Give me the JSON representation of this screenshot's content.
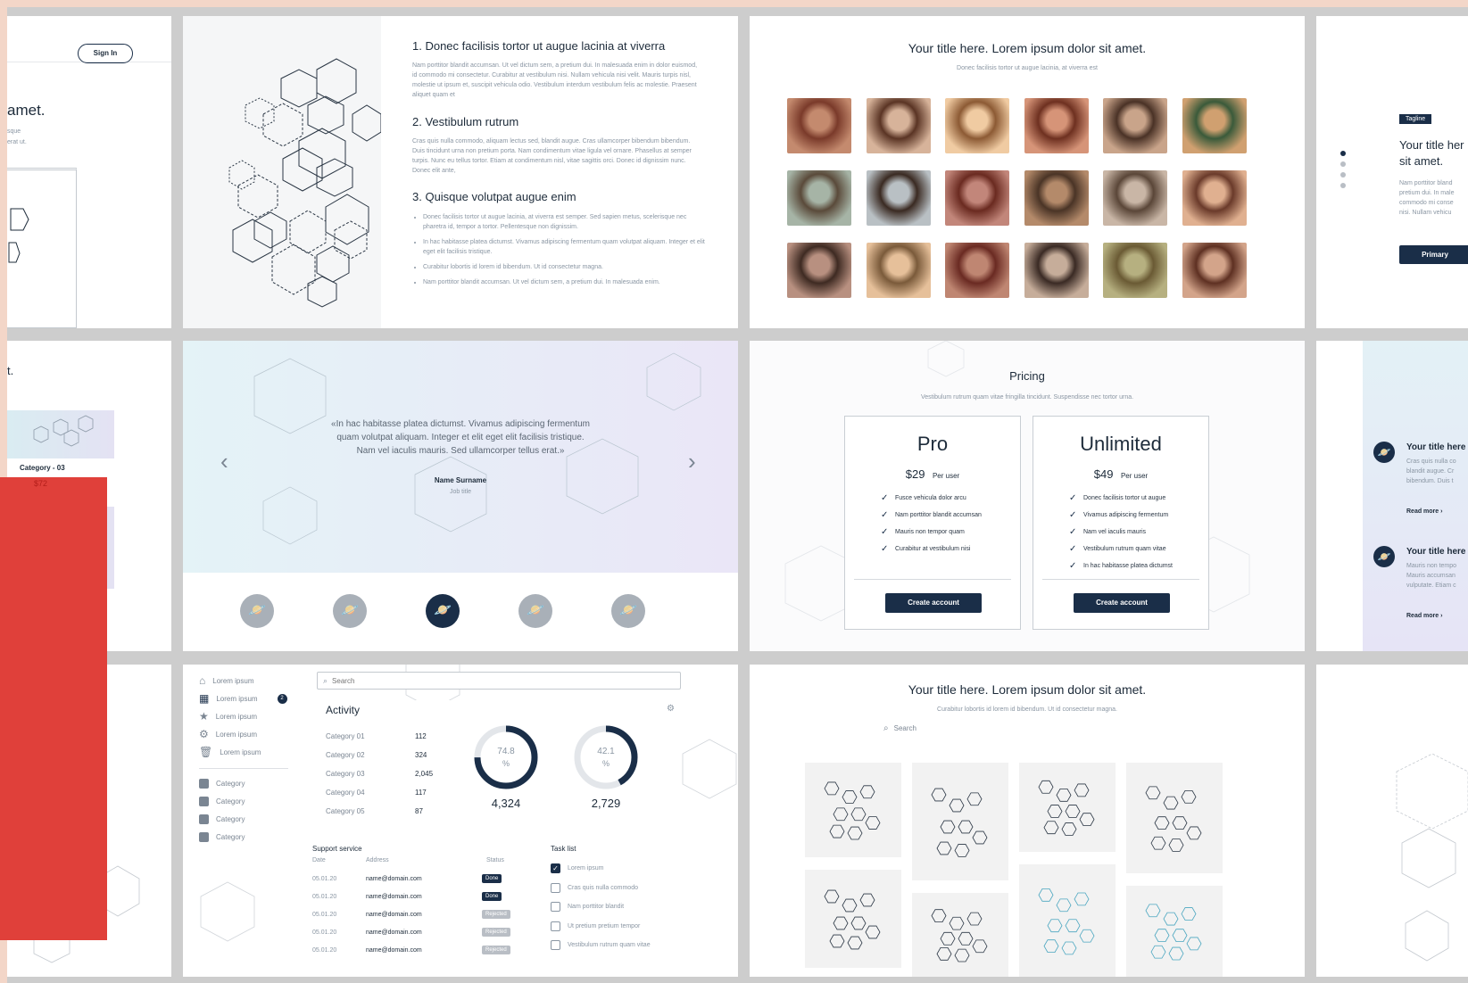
{
  "signin": {
    "button": "Sign In",
    "title_fragment": "amet.",
    "text_1": "sque",
    "text_2": "erat ut."
  },
  "list_card": {
    "heading_1": "1. Donec facilisis tortor ut augue lacinia at viverra",
    "para_1": "Nam porttitor blandit accumsan. Ut vel dictum sem, a pretium dui. In malesuada enim in dolor euismod, id commodo mi consectetur. Curabitur at vestibulum nisi. Nullam vehicula nisi velit. Mauris turpis nisl, molestie ut ipsum et, suscipit vehicula odio. Vestibulum interdum vestibulum felis ac molestie. Praesent aliquet quam et",
    "heading_2": "2. Vestibulum rutrum",
    "para_2": "Cras quis nulla commodo, aliquam lectus sed, blandit augue. Cras ullamcorper bibendum bibendum. Duis tincidunt urna non pretium porta. Nam condimentum vitae ligula vel ornare. Phasellus at semper turpis. Nunc eu tellus tortor. Etiam at condimentum nisl, vitae sagittis orci. Donec id dignissim nunc. Donec elit ante,",
    "heading_3": "3. Quisque volutpat augue enim",
    "bullets": [
      "Donec facilisis tortor ut augue lacinia, at viverra est semper. Sed sapien metus, scelerisque nec pharetra id, tempor a tortor. Pellentesque non dignissim.",
      "In hac habitasse platea dictumst. Vivamus adipiscing fermentum quam volutpat aliquam. Integer et elit eget elit facilisis tristique.",
      "Curabitur lobortis id lorem id bibendum. Ut id consectetur magna.",
      "Nam porttitor blandit accumsan. Ut vel dictum sem, a pretium dui. In malesuada enim."
    ]
  },
  "gallery": {
    "title": "Your title here. Lorem ipsum dolor sit amet.",
    "subtitle": "Donec facilisis tortor ut augue lacinia, at viverra est"
  },
  "tagline_card": {
    "tag": "Tagline",
    "title_1": "Your title her",
    "title_2": "sit amet.",
    "text": [
      "Nam porttitor bland",
      "pretium dui. In male",
      "commodo mi conse",
      "nisi. Nullam vehicu"
    ],
    "button": "Primary"
  },
  "category_card": {
    "fragment": "t.",
    "label": "Category - 03",
    "price": "$72"
  },
  "testimonial": {
    "quote_1": "«In hac habitasse platea dictumst. Vivamus adipiscing fermentum",
    "quote_2": "quam volutpat aliquam. Integer et elit eget elit facilisis tristique.",
    "quote_3": "Nam vel iaculis mauris. Sed ullamcorper tellus erat.»",
    "name": "Name Surname",
    "job": "Job title",
    "prev": "‹",
    "next": "›"
  },
  "pricing": {
    "title": "Pricing",
    "subtitle": "Vestibulum rutrum quam vitae fringilla tincidunt. Suspendisse nec tortor urna.",
    "plans": [
      {
        "name": "Pro",
        "price": "$29",
        "unit": "Per user",
        "features": [
          "Fusce vehicula dolor arcu",
          "Nam porttitor blandit accumsan",
          "Mauris non tempor quam",
          "Curabitur at vestibulum nisi"
        ],
        "button": "Create account"
      },
      {
        "name": "Unlimited",
        "price": "$49",
        "unit": "Per user",
        "features": [
          "Donec facilisis tortor ut augue",
          "Vivamus adipiscing fermentum",
          "Nam vel iaculis mauris",
          "Vestibulum rutrum quam vitae",
          "In hac habitasse platea dictumst"
        ],
        "button": "Create account"
      }
    ]
  },
  "features_card": {
    "title_1": "Your title here",
    "text_1": [
      "Cras quis nulla co",
      "blandit augue. Cr",
      "bibendum. Duis t"
    ],
    "read_1": "Read more",
    "title_2": "Your title here",
    "text_2": [
      "Mauris non tempo",
      "Mauris accumsan",
      "vulputate. Etiam c"
    ],
    "read_2": "Read more"
  },
  "dashboard": {
    "search_placeholder": "Search",
    "sidebar": [
      "Lorem ipsum",
      "Lorem ipsum",
      "Lorem ipsum",
      "Lorem ipsum",
      "Lorem ipsum"
    ],
    "sidebar_badge": "2",
    "categories": [
      "Category",
      "Category",
      "Category",
      "Category"
    ],
    "activity_title": "Activity",
    "activity_rows": [
      {
        "label": "Category 01",
        "value": "112"
      },
      {
        "label": "Category 02",
        "value": "324"
      },
      {
        "label": "Category 03",
        "value": "2,045"
      },
      {
        "label": "Category 04",
        "value": "117"
      },
      {
        "label": "Category 05",
        "value": "87"
      }
    ],
    "donut_1": {
      "percent": "74.8",
      "unit": "%",
      "total": "4,324",
      "fraction": 0.748
    },
    "donut_2": {
      "percent": "42.1",
      "unit": "%",
      "total": "2,729",
      "fraction": 0.421
    },
    "support_title": "Support service",
    "support_headers": [
      "Date",
      "Address",
      "Status"
    ],
    "support_rows": [
      {
        "date": "05.01.20",
        "address": "name@domain.com",
        "status": "Done"
      },
      {
        "date": "05.01.20",
        "address": "name@domain.com",
        "status": "Done"
      },
      {
        "date": "05.01.20",
        "address": "name@domain.com",
        "status": "Rejected"
      },
      {
        "date": "05.01.20",
        "address": "name@domain.com",
        "status": "Rejected"
      },
      {
        "date": "05.01.20",
        "address": "name@domain.com",
        "status": "Rejected"
      }
    ],
    "task_title": "Task list",
    "tasks": [
      {
        "label": "Lorem ipsum",
        "done": true
      },
      {
        "label": "Cras quis nulla commodo",
        "done": false
      },
      {
        "label": "Nam porttitor blandit",
        "done": false
      },
      {
        "label": "Ut pretium pretium tempor",
        "done": false
      },
      {
        "label": "Vestibulum rutrum quam vitae",
        "done": false
      }
    ]
  },
  "illustrations": {
    "title": "Your title here. Lorem ipsum dolor sit amet.",
    "subtitle": "Curabitur lobortis id lorem id bibendum. Ut id consectetur magna.",
    "search": "Search"
  },
  "colors": {
    "navy": "#1a2e48",
    "accent_red": "#e0403a",
    "background": "#cdcdcd",
    "band": "#f3d6c8"
  }
}
